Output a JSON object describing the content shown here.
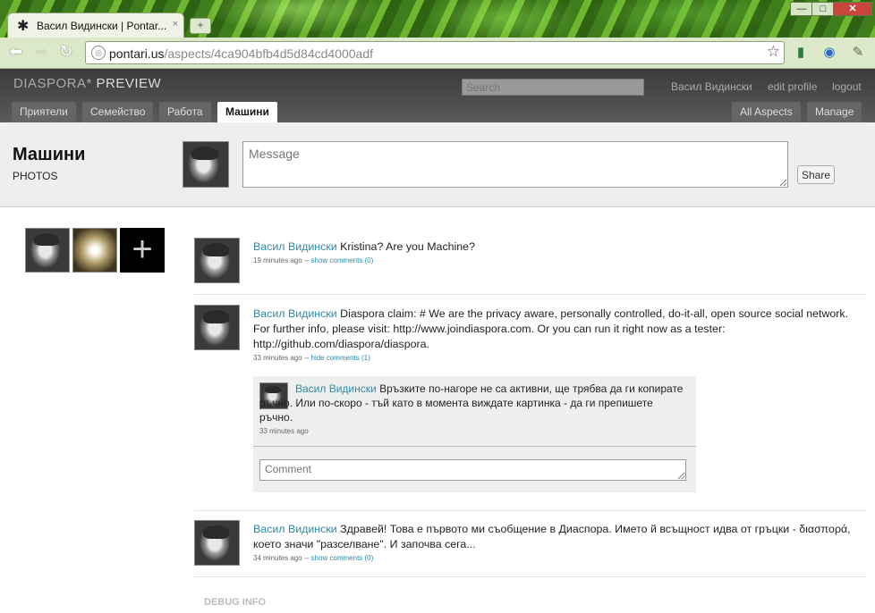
{
  "browser": {
    "tab_title": "Васил Видински | Pontar...",
    "tab_close": "×",
    "new_tab": "+",
    "url_host": "pontari.us",
    "url_path": "/aspects/4ca904bfb4d5d84cd4000adf",
    "window_min": "—",
    "window_max": "□",
    "window_close": "✕"
  },
  "header": {
    "logo": "DIASPORA*",
    "logo_preview": "PREVIEW",
    "search_placeholder": "Search",
    "user": "Васил Видински",
    "edit_profile": "edit profile",
    "logout": "logout",
    "aspect_tabs": [
      "Приятели",
      "Семейство",
      "Работа",
      "Машини"
    ],
    "active_tab": "Машини",
    "all_aspects": "All Aspects",
    "manage": "Manage"
  },
  "aspect": {
    "title": "Машини",
    "subtitle": "PHOTOS",
    "message_placeholder": "Message",
    "share_label": "Share"
  },
  "contacts": {
    "add_label": "+"
  },
  "posts": [
    {
      "author": "Васил Видински",
      "text": "Kristina? Are you Machine?",
      "time": "19 minutes ago",
      "sep": "--",
      "comments_link": "show comments (0)"
    },
    {
      "author": "Васил Видински",
      "text": "Diaspora claim: # We are the privacy aware, personally controlled, do-it-all, open source social network. For further info, please visit: http://www.joindiaspora.com. Or you can run it right now as a tester: http://github.com/diaspora/diaspora.",
      "time": "33 minutes ago",
      "sep": "--",
      "comments_link": "hide comments (1)"
    },
    {
      "author": "Васил Видински",
      "text": "Здравей! Това е първото ми съобщение в Диаспора. Името й всъщност идва от гръцки - διασπορά, което значи \"разселване\". И започва сега...",
      "time": "34 minutes ago",
      "sep": "--",
      "comments_link": "show comments (0)"
    }
  ],
  "comment": {
    "author": "Васил Видински",
    "text": "Връзките по-нагоре не са активни, ще трябва да ги копирате ръчно. Или по-скоро - тъй като в момента виждате картинка - да ги препишете ръчно.",
    "time": "33 minutes ago",
    "placeholder": "Comment"
  },
  "footer": {
    "debug": "DEBUG INFO"
  }
}
